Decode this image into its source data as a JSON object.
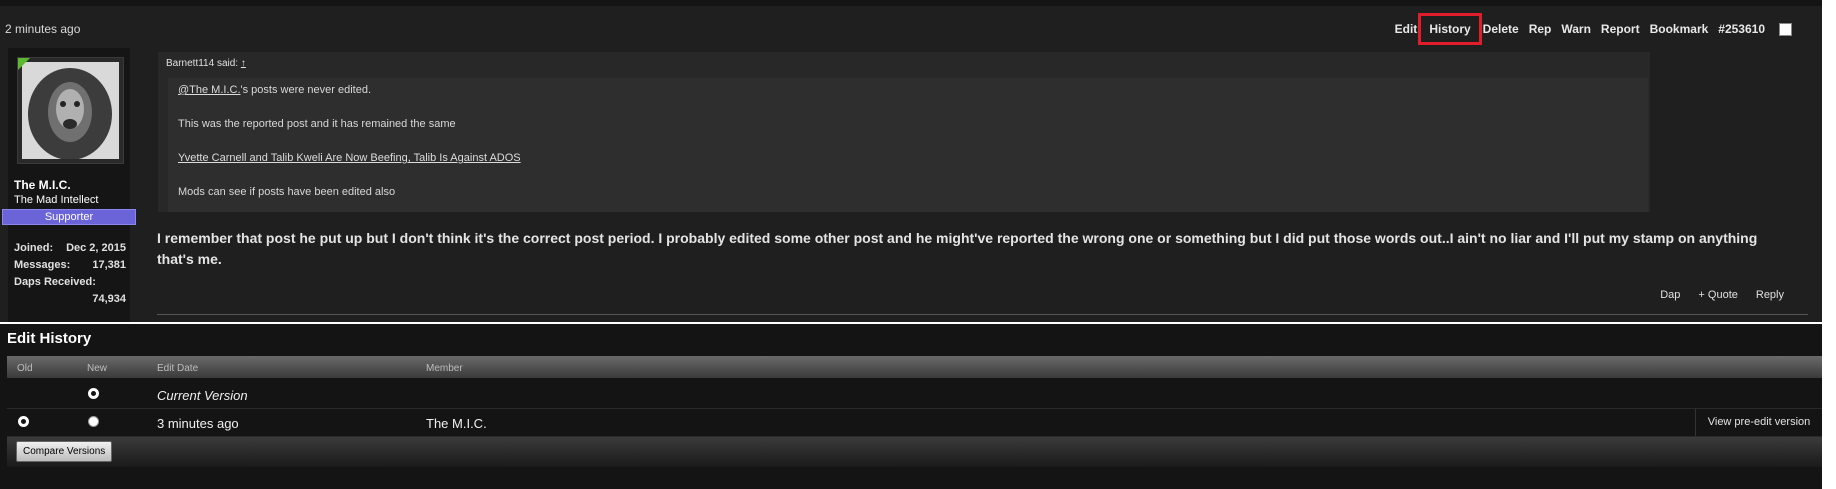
{
  "post": {
    "time": "2 minutes ago",
    "controls": [
      "Edit",
      "History",
      "Delete",
      "Rep",
      "Warn",
      "Report",
      "Bookmark",
      "#253610"
    ],
    "user": {
      "name": "The M.I.C.",
      "title": "The Mad Intellect",
      "badge": "Supporter",
      "stats": {
        "joined_label": "Joined:",
        "joined_value": "Dec 2, 2015",
        "messages_label": "Messages:",
        "messages_value": "17,381",
        "daps_label": "Daps Received:",
        "daps_value": "74,934"
      }
    },
    "quote": {
      "author": "Barnett114 said:",
      "arrow": "↑",
      "mention": "@The M.I.C.",
      "line1_rest": "'s posts were never edited.",
      "line2": "This was the reported post and it has remained the same",
      "link": "Yvette Carnell and Talib Kweli Are Now Beefing, Talib Is Against ADOS",
      "line4": "Mods can see if posts have been edited also"
    },
    "message": "I remember that post he put up but I don't think it's the correct post period. I probably edited some other post and he might've reported the wrong one or something but I did put those words out..I ain't no liar and I'll put my stamp on anything that's me.",
    "footer": {
      "dap": "Dap",
      "quote": "+ Quote",
      "reply": "Reply"
    }
  },
  "history": {
    "title": "Edit History",
    "headers": {
      "old": "Old",
      "new": "New",
      "edit_date": "Edit Date",
      "member": "Member"
    },
    "rows": [
      {
        "edit_date": "Current Version",
        "member": ""
      },
      {
        "edit_date": "3 minutes ago",
        "member": "The M.I.C.",
        "action": "View pre-edit version"
      }
    ],
    "compare_button": "Compare Versions"
  },
  "colors": {
    "highlight": "#e01e2b",
    "badge": "#6a64d8",
    "online": "#5cb82e"
  }
}
